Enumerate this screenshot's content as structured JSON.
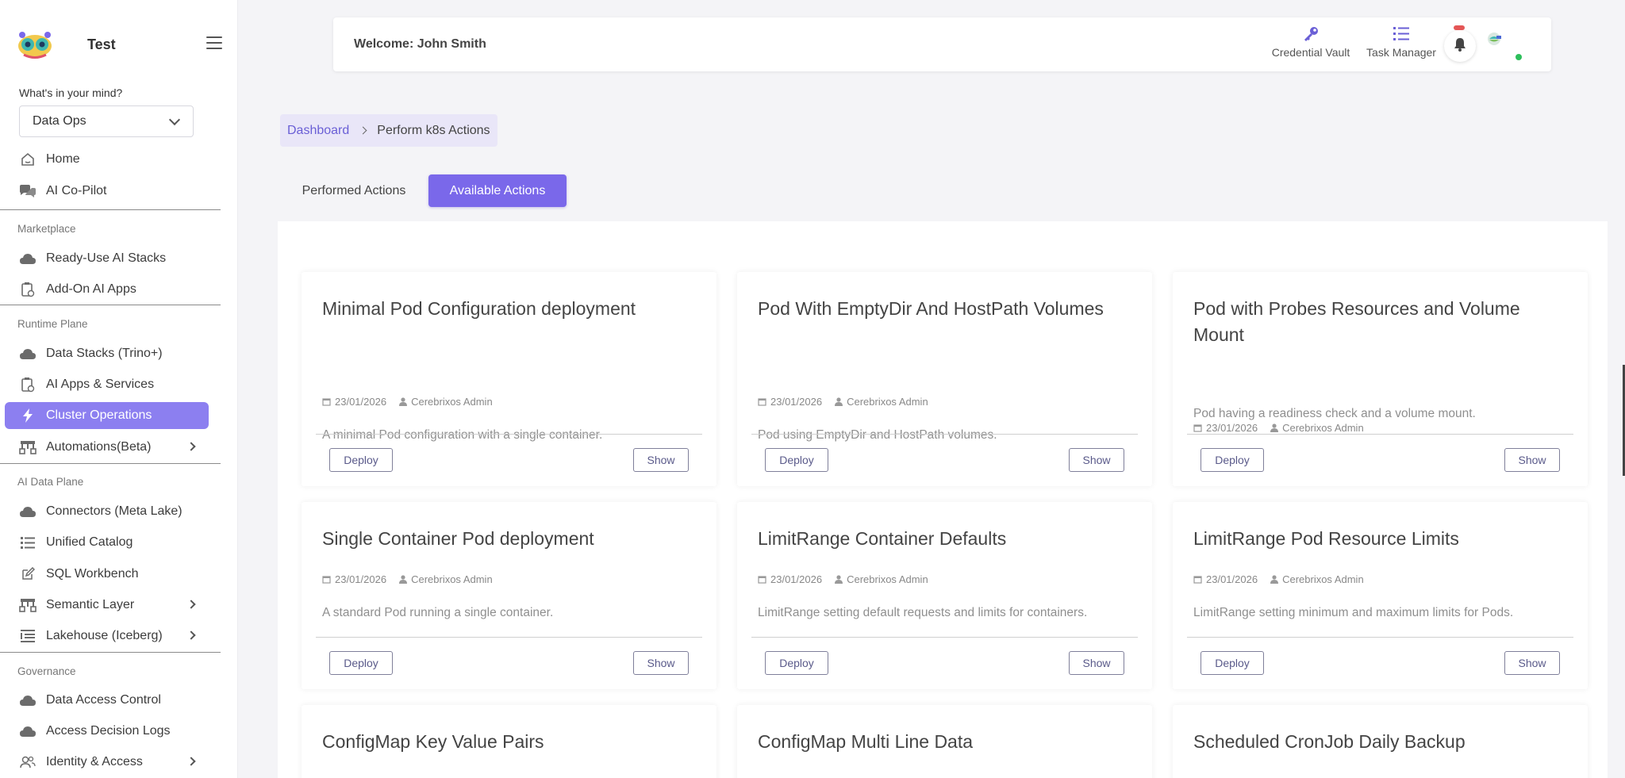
{
  "sidebar": {
    "brand": "Test",
    "mind_label": "What's in your mind?",
    "mind_value": "Data Ops",
    "items": [
      {
        "label": "Home",
        "icon": "home-icon"
      },
      {
        "label": "AI Co-Pilot",
        "icon": "chat-icon"
      },
      {
        "label": "Ready-Use AI Stacks",
        "icon": "cloud-icon"
      },
      {
        "label": "Add-On AI Apps",
        "icon": "apps-icon"
      },
      {
        "label": "Data Stacks (Trino+)",
        "icon": "cloud-icon"
      },
      {
        "label": "AI Apps & Services",
        "icon": "apps-icon"
      },
      {
        "label": "Cluster Operations",
        "icon": "bolt-icon"
      },
      {
        "label": "Automations(Beta)",
        "icon": "hierarchy-icon"
      },
      {
        "label": "Connectors (Meta Lake)",
        "icon": "cloud-icon"
      },
      {
        "label": "Unified Catalog",
        "icon": "list-icon"
      },
      {
        "label": "SQL Workbench",
        "icon": "edit-icon"
      },
      {
        "label": "Semantic Layer",
        "icon": "hierarchy-icon"
      },
      {
        "label": "Lakehouse (Iceberg)",
        "icon": "list-icon"
      },
      {
        "label": "Data Access Control",
        "icon": "cloud-icon"
      },
      {
        "label": "Access Decision Logs",
        "icon": "cloud-icon"
      },
      {
        "label": "Identity & Access",
        "icon": "users-icon"
      }
    ],
    "sections": {
      "marketplace": "Marketplace",
      "runtime": "Runtime Plane",
      "ai_data": "AI Data Plane",
      "governance": "Governance"
    }
  },
  "header": {
    "welcome": "Welcome: John Smith",
    "credential_vault": "Credential Vault",
    "task_manager": "Task Manager"
  },
  "breadcrumb": {
    "root": "Dashboard",
    "current": "Perform k8s Actions"
  },
  "tabs": {
    "performed": "Performed Actions",
    "available": "Available Actions"
  },
  "colors": {
    "accent": "#7a68ea",
    "active_nav": "#8c7ff0",
    "online": "#2dbf5b",
    "badge": "#e45656"
  },
  "buttons": {
    "deploy": "Deploy",
    "show": "Show"
  },
  "cards": [
    {
      "title": "Minimal Pod Configuration deployment",
      "date": "23/01/2026",
      "author": "Cerebrixos Admin",
      "description": "A minimal Pod configuration with a single container."
    },
    {
      "title": "Pod With EmptyDir And HostPath Volumes",
      "date": "23/01/2026",
      "author": "Cerebrixos Admin",
      "description": "Pod using EmptyDir and HostPath volumes."
    },
    {
      "title": "Pod with Probes Resources and Volume Mount",
      "date": "23/01/2026",
      "author": "Cerebrixos Admin",
      "description": "Pod having a readiness check and a volume mount."
    },
    {
      "title": "Single Container Pod deployment",
      "date": "23/01/2026",
      "author": "Cerebrixos Admin",
      "description": "A standard Pod running a single container."
    },
    {
      "title": "LimitRange Container Defaults",
      "date": "23/01/2026",
      "author": "Cerebrixos Admin",
      "description": "LimitRange setting default requests and limits for containers."
    },
    {
      "title": "LimitRange Pod Resource Limits",
      "date": "23/01/2026",
      "author": "Cerebrixos Admin",
      "description": "LimitRange setting minimum and maximum limits for Pods."
    },
    {
      "title": "ConfigMap Key Value Pairs"
    },
    {
      "title": "ConfigMap Multi Line Data"
    },
    {
      "title": "Scheduled CronJob Daily Backup"
    }
  ]
}
